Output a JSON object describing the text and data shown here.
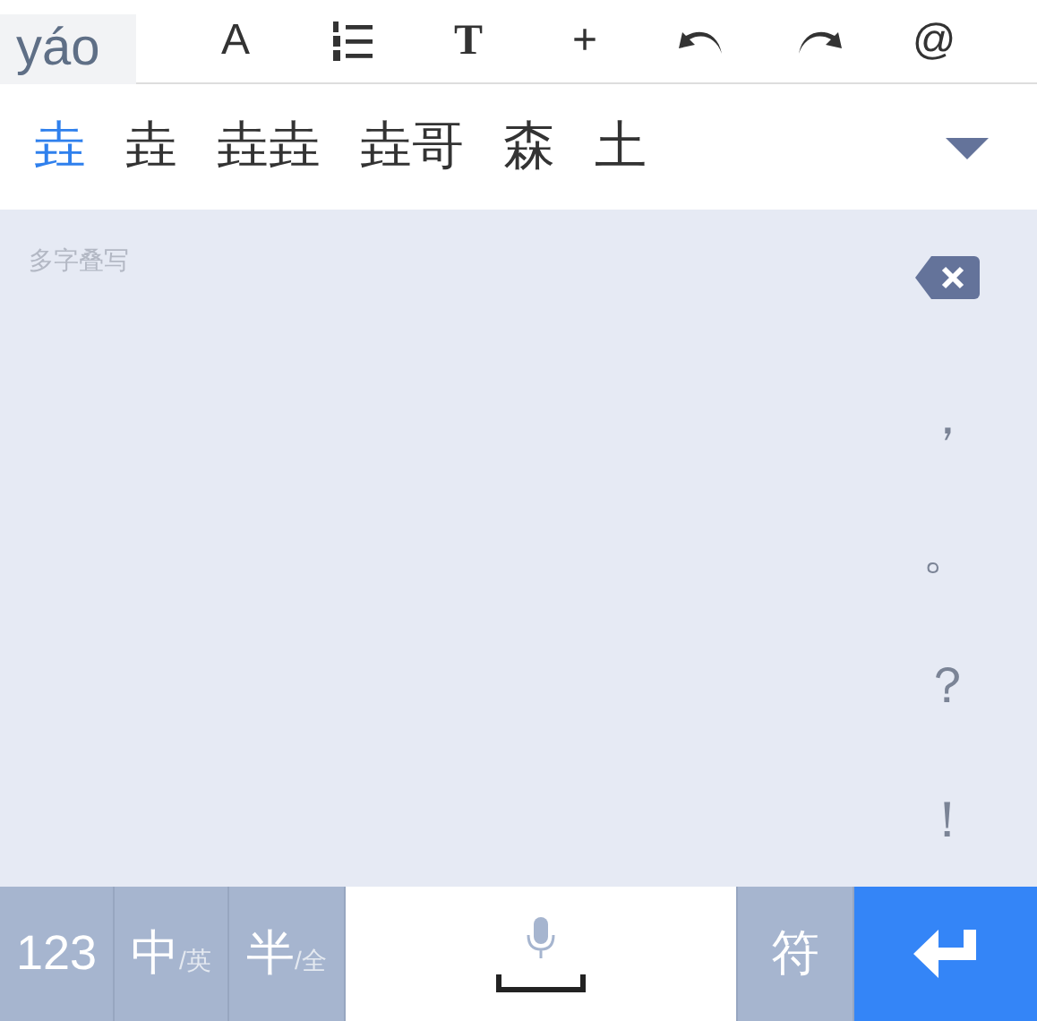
{
  "composition": "yáo",
  "toolbar": [
    {
      "kind": "text",
      "label": "A"
    },
    {
      "kind": "list"
    },
    {
      "kind": "text",
      "label": "T"
    },
    {
      "kind": "text",
      "label": "+"
    },
    {
      "kind": "undo"
    },
    {
      "kind": "redo"
    },
    {
      "kind": "text",
      "label": "@"
    }
  ],
  "candidates": [
    {
      "label": "垚",
      "selected": true
    },
    {
      "label": "垚",
      "selected": false
    },
    {
      "label": "垚垚",
      "selected": false
    },
    {
      "label": "垚哥",
      "selected": false
    },
    {
      "label": "森",
      "selected": false
    },
    {
      "label": "土",
      "selected": false
    }
  ],
  "handwriting": {
    "hint": "多字叠写"
  },
  "side_keys": [
    {
      "kind": "delete"
    },
    {
      "kind": "text",
      "label": "，"
    },
    {
      "kind": "text",
      "label": "。"
    },
    {
      "kind": "text",
      "label": "？"
    },
    {
      "kind": "text",
      "label": "！"
    }
  ],
  "bottom_keys": [
    {
      "kind": "text",
      "label": "123"
    },
    {
      "kind": "text",
      "label": "中",
      "sub": "/英"
    },
    {
      "kind": "text",
      "label": "半",
      "sub": "/全"
    },
    {
      "kind": "space"
    },
    {
      "kind": "text",
      "label": "符"
    },
    {
      "kind": "enter"
    }
  ]
}
